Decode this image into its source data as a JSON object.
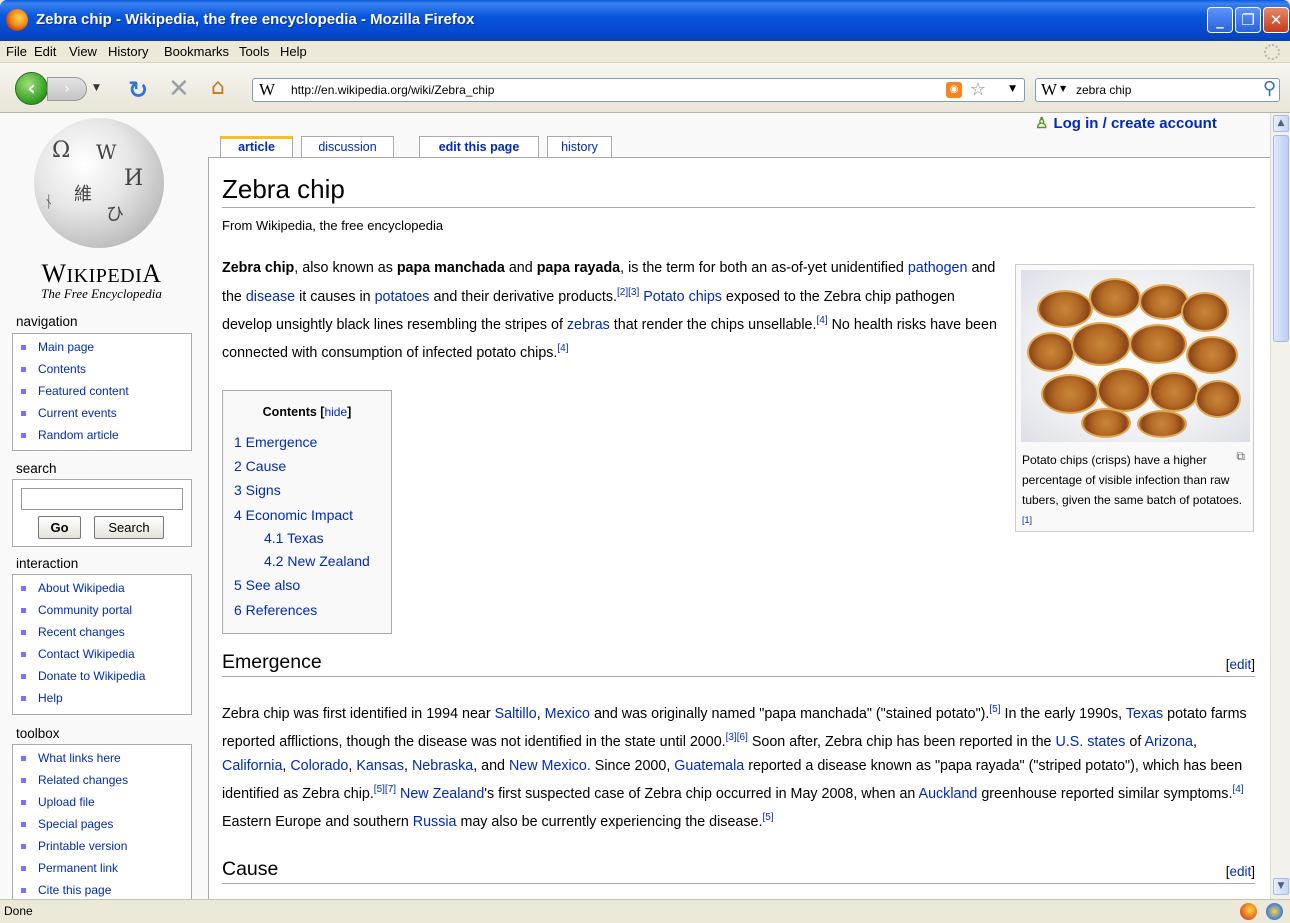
{
  "window": {
    "title": "Zebra chip - Wikipedia, the free encyclopedia - Mozilla Firefox",
    "controls": [
      "minimize",
      "restore",
      "close"
    ]
  },
  "menu": [
    "File",
    "Edit",
    "View",
    "History",
    "Bookmarks",
    "Tools",
    "Help"
  ],
  "toolbar": {
    "url": "http://en.wikipedia.org/wiki/Zebra_chip",
    "site_glyph": "W",
    "search_engine_glyph": "W",
    "search_query": "zebra chip",
    "feed_label": "RSS"
  },
  "status": {
    "text": "Done"
  },
  "wiki": {
    "logo_name": "Wikipedia",
    "logo_tagline": "The Free Encyclopedia",
    "user_link": "Log in / create account",
    "tabs": [
      {
        "label": "article",
        "selected": true
      },
      {
        "label": "discussion",
        "selected": false
      },
      {
        "label": "edit this page",
        "selected": false
      },
      {
        "label": "history",
        "selected": false
      }
    ],
    "navigation": {
      "heading": "navigation",
      "items": [
        "Main page",
        "Contents",
        "Featured content",
        "Current events",
        "Random article"
      ]
    },
    "search": {
      "heading": "search",
      "go": "Go",
      "search": "Search"
    },
    "interaction": {
      "heading": "interaction",
      "items": [
        "About Wikipedia",
        "Community portal",
        "Recent changes",
        "Contact Wikipedia",
        "Donate to Wikipedia",
        "Help"
      ]
    },
    "toolbox": {
      "heading": "toolbox",
      "items": [
        "What links here",
        "Related changes",
        "Upload file",
        "Special pages",
        "Printable version",
        "Permanent link",
        "Cite this page"
      ]
    },
    "article": {
      "title": "Zebra chip",
      "subtitle": "From Wikipedia, the free encyclopedia",
      "toc": {
        "title": "Contents",
        "hide": "hide",
        "items": [
          "1 Emergence",
          "2 Cause",
          "3 Signs",
          "4 Economic Impact",
          "4.1 Texas",
          "4.2 New Zealand",
          "5 See also",
          "6 References"
        ]
      },
      "thumb_caption": "Potato chips (crisps) have a higher percentage of visible infection than raw tubers, given the same batch of potatoes.",
      "thumb_ref": "[1]",
      "sections": [
        {
          "heading": "Emergence",
          "edit": "edit"
        },
        {
          "heading": "Cause",
          "edit": "edit"
        }
      ]
    }
  }
}
